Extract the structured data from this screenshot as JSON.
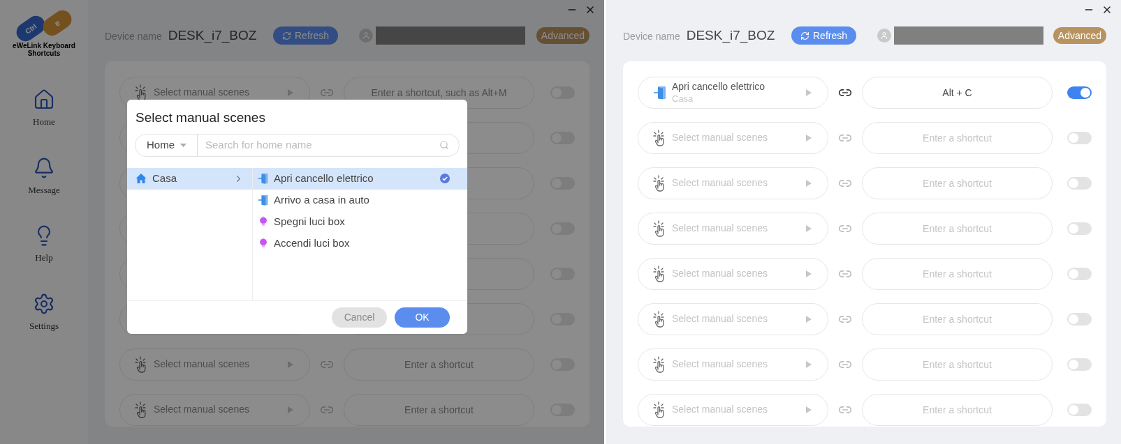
{
  "left": {
    "sidebar": {
      "logo": {
        "badges": [
          "Ctrl",
          "e"
        ],
        "title": "eWeLink Keyboard Shortcuts"
      },
      "items": [
        {
          "label": "Home",
          "kind": "home"
        },
        {
          "label": "Message",
          "kind": "bell"
        },
        {
          "label": "Help",
          "kind": "bulb"
        },
        {
          "label": "Settings",
          "kind": "gear"
        }
      ]
    },
    "header": {
      "device_label": "Device name",
      "device_name": "DESK_i7_BOZ",
      "refresh": "Refresh",
      "advanced": "Advanced"
    },
    "rows": [
      {
        "scene_placeholder": "Select manual scenes",
        "shortcut_placeholder": "Enter a shortcut, such as Alt+M",
        "on": false
      },
      {
        "on": false
      },
      {
        "on": false
      },
      {
        "on": false
      },
      {
        "on": false
      },
      {
        "on": false
      },
      {
        "scene_placeholder": "Select manual scenes",
        "shortcut_placeholder": "Enter a shortcut",
        "on": false
      },
      {
        "scene_placeholder": "Select manual scenes",
        "shortcut_placeholder": "Enter a shortcut",
        "on": false
      }
    ],
    "dialog": {
      "title": "Select manual scenes",
      "home_select": "Home",
      "search_placeholder": "Search for home name",
      "homes": [
        {
          "name": "Casa",
          "selected": true
        }
      ],
      "scenes": [
        {
          "name": "Apri cancello elettrico",
          "kind": "door",
          "selected": true
        },
        {
          "name": "Arrivo a casa in auto",
          "kind": "door",
          "selected": false
        },
        {
          "name": "Spegni luci box",
          "kind": "bulb",
          "selected": false
        },
        {
          "name": "Accendi luci box",
          "kind": "bulb",
          "selected": false
        }
      ],
      "cancel": "Cancel",
      "ok": "OK"
    }
  },
  "right": {
    "header": {
      "device_label": "Device name",
      "device_name": "DESK_i7_BOZ",
      "refresh": "Refresh",
      "advanced": "Advanced"
    },
    "rows": [
      {
        "scene": {
          "name": "Apri cancello elettrico",
          "home": "Casa",
          "kind": "door"
        },
        "shortcut": "Alt + C",
        "on": true
      },
      {
        "scene_placeholder": "Select manual scenes",
        "shortcut_placeholder": "Enter a shortcut",
        "on": false
      },
      {
        "scene_placeholder": "Select manual scenes",
        "shortcut_placeholder": "Enter a shortcut",
        "on": false
      },
      {
        "scene_placeholder": "Select manual scenes",
        "shortcut_placeholder": "Enter a shortcut",
        "on": false
      },
      {
        "scene_placeholder": "Select manual scenes",
        "shortcut_placeholder": "Enter a shortcut",
        "on": false
      },
      {
        "scene_placeholder": "Select manual scenes",
        "shortcut_placeholder": "Enter a shortcut",
        "on": false
      },
      {
        "scene_placeholder": "Select manual scenes",
        "shortcut_placeholder": "Enter a shortcut",
        "on": false
      },
      {
        "scene_placeholder": "Select manual scenes",
        "shortcut_placeholder": "Enter a shortcut",
        "on": false
      }
    ]
  }
}
